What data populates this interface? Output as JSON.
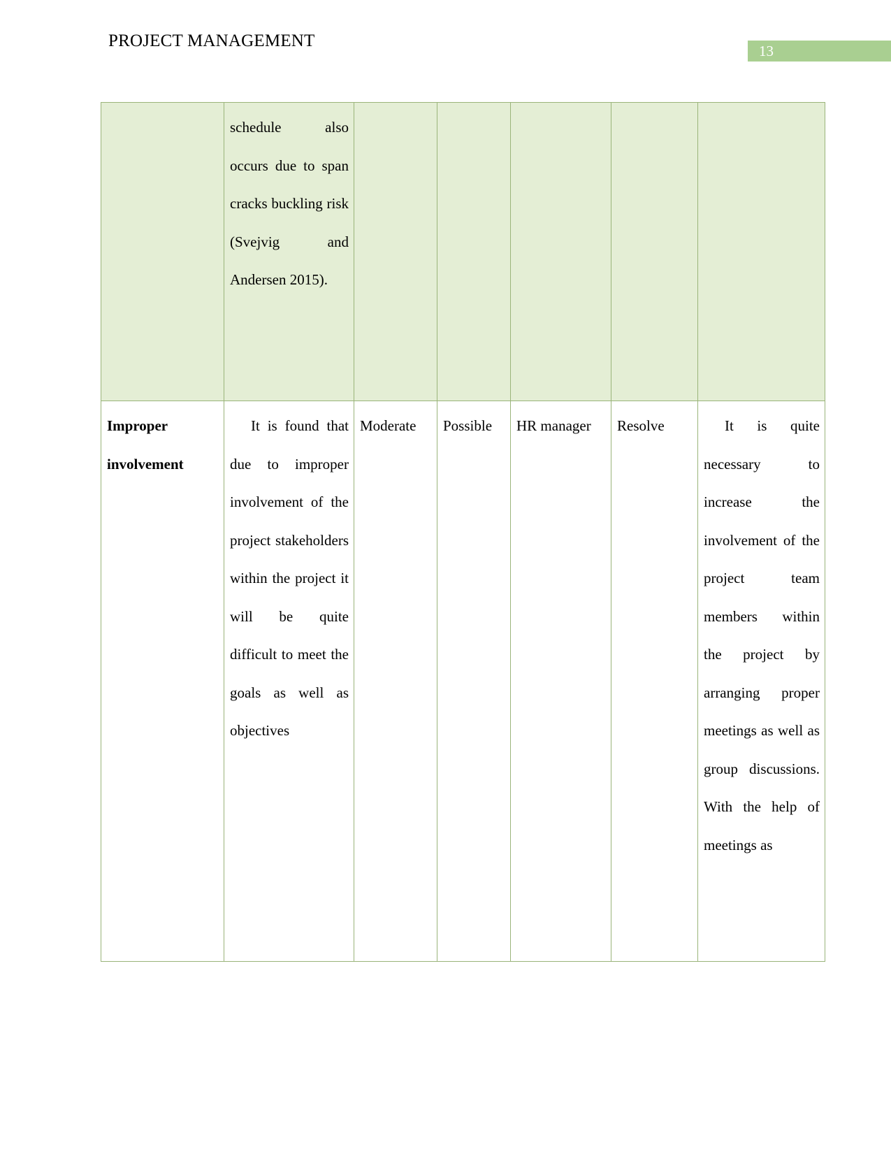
{
  "header": {
    "title": "PROJECT MANAGEMENT",
    "page_number": "13",
    "page_number_box_color": "#a9cf91",
    "page_number_text_color": "#ffffff"
  },
  "table": {
    "border_color": "#9ab47a",
    "shaded_row_color": "#e4eed5",
    "column_count": 7,
    "rows": [
      {
        "type": "continued-row",
        "shaded": true,
        "cells": {
          "risk": "",
          "description": "schedule also occurs due to span cracks buckling risk (Svejvig and Andersen 2015).",
          "impact": "",
          "likelihood": "",
          "owner": "",
          "response": "",
          "mitigation": ""
        }
      },
      {
        "type": "risk-row",
        "shaded": false,
        "cells": {
          "risk": "Improper involvement",
          "description": "It is found that due to improper involvement of the project stakeholders within the project it will be quite difficult to meet the goals as well as objectives",
          "impact": "Moderate",
          "likelihood": "Possible",
          "owner": "HR manager",
          "response": "Resolve",
          "mitigation": "It is quite necessary to increase the involvement of the project team members within the project by arranging proper meetings as well as group discussions. With the help of meetings as"
        }
      }
    ]
  }
}
